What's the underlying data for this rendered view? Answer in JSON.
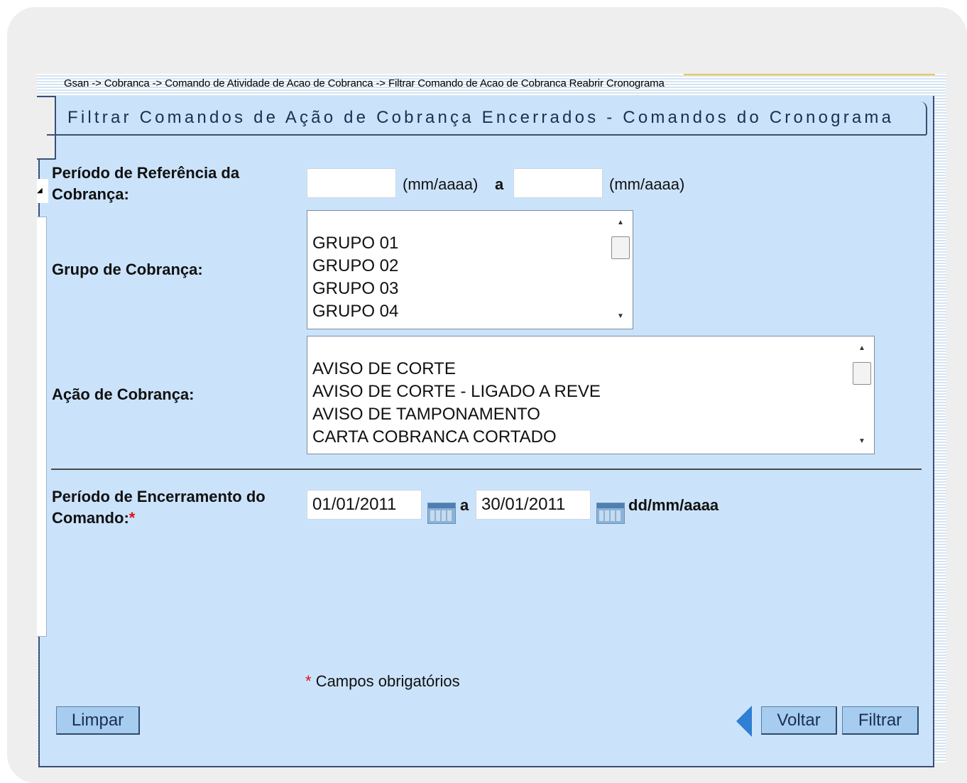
{
  "breadcrumb": "Gsan -> Cobranca -> Comando de Atividade de Acao de Cobranca -> Filtrar Comando de Acao de Cobranca Reabrir Cronograma",
  "title": "Filtrar Comandos de Ação de Cobrança Encerrados - Comandos do Cronograma",
  "periodo_referencia": {
    "label": "Período de Referência da Cobrança:",
    "start_value": "",
    "format1": "(mm/aaaa)",
    "sep": "a",
    "end_value": "",
    "format2": "(mm/aaaa)"
  },
  "grupo_cobranca": {
    "label": "Grupo de Cobrança:",
    "options": [
      "GRUPO 01",
      "GRUPO 02",
      "GRUPO 03",
      "GRUPO 04"
    ]
  },
  "acao_cobranca": {
    "label": "Ação de Cobrança:",
    "options": [
      "AVISO DE CORTE",
      "AVISO DE CORTE - LIGADO A REVE",
      "AVISO DE TAMPONAMENTO",
      "CARTA COBRANCA CORTADO"
    ]
  },
  "periodo_encerramento": {
    "label": "Período de Encerramento do Comando:",
    "required_mark": "*",
    "start_value": "01/01/2011",
    "sep": "a",
    "end_value": "30/01/2011",
    "format": "dd/mm/aaaa"
  },
  "required_note": {
    "mark": "*",
    "text": "Campos obrigatórios"
  },
  "buttons": {
    "limpar": "Limpar",
    "voltar": "Voltar",
    "filtrar": "Filtrar"
  }
}
